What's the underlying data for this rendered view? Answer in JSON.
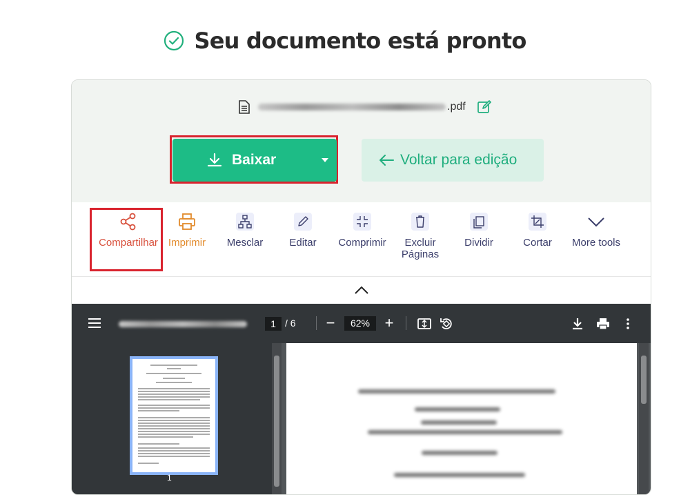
{
  "header": {
    "title": "Seu documento está pronto",
    "check_icon": "check-circle-icon"
  },
  "file": {
    "extension": ".pdf",
    "doc_icon": "document-icon",
    "rename_icon": "edit-icon"
  },
  "actions": {
    "download_label": "Baixar",
    "back_label": "Voltar para edição"
  },
  "tools": [
    {
      "label": "Compartilhar",
      "icon": "share-icon"
    },
    {
      "label": "Imprimir",
      "icon": "printer-icon"
    },
    {
      "label": "Mesclar",
      "icon": "merge-icon"
    },
    {
      "label": "Editar",
      "icon": "pencil-icon"
    },
    {
      "label": "Comprimir",
      "icon": "compress-icon"
    },
    {
      "label": "Excluir Páginas",
      "icon": "trash-icon"
    },
    {
      "label": "Dividir",
      "icon": "split-icon"
    },
    {
      "label": "Cortar",
      "icon": "crop-icon"
    },
    {
      "label": "More tools",
      "icon": "chevron-down-icon"
    }
  ],
  "viewer": {
    "current_page": "1",
    "page_total": "/ 6",
    "zoom": "62%",
    "thumbnail_page": "1"
  },
  "colors": {
    "primary_green": "#1dbc86",
    "highlight_red": "#d9232e",
    "share_color": "#d8503c",
    "print_color": "#e28a2b",
    "tool_text": "#3a3d6a"
  }
}
